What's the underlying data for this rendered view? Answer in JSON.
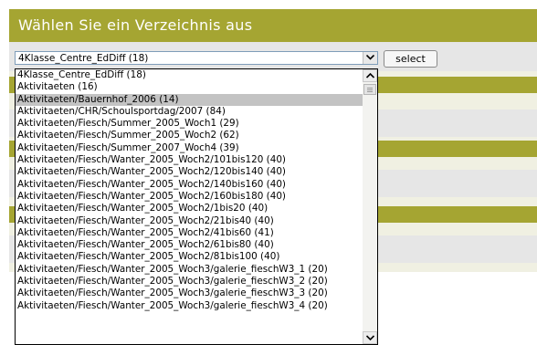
{
  "header": {
    "title": "Wählen Sie ein Verzeichnis aus"
  },
  "form": {
    "selected_value": "4Klasse_Centre_EdDiff (18)",
    "select_button_label": "select"
  },
  "dropdown": {
    "highlighted_index": 2,
    "options": [
      "4Klasse_Centre_EdDiff (18)",
      "Aktivitaeten (16)",
      "Aktivitaeten/Bauernhof_2006 (14)",
      "Aktivitaeten/CHR/Schoulsportdag/2007 (84)",
      "Aktivitaeten/Fiesch/Summer_2005_Woch1 (29)",
      "Aktivitaeten/Fiesch/Summer_2005_Woch2 (62)",
      "Aktivitaeten/Fiesch/Summer_2007_Woch4 (39)",
      "Aktivitaeten/Fiesch/Wanter_2005_Woch2/101bis120 (40)",
      "Aktivitaeten/Fiesch/Wanter_2005_Woch2/120bis140 (40)",
      "Aktivitaeten/Fiesch/Wanter_2005_Woch2/140bis160 (40)",
      "Aktivitaeten/Fiesch/Wanter_2005_Woch2/160bis180 (40)",
      "Aktivitaeten/Fiesch/Wanter_2005_Woch2/1bis20 (40)",
      "Aktivitaeten/Fiesch/Wanter_2005_Woch2/21bis40 (40)",
      "Aktivitaeten/Fiesch/Wanter_2005_Woch2/41bis60 (41)",
      "Aktivitaeten/Fiesch/Wanter_2005_Woch2/61bis80 (40)",
      "Aktivitaeten/Fiesch/Wanter_2005_Woch2/81bis100 (40)",
      "Aktivitaeten/Fiesch/Wanter_2005_Woch3/galerie_fieschW3_1 (20)",
      "Aktivitaeten/Fiesch/Wanter_2005_Woch3/galerie_fieschW3_2 (20)",
      "Aktivitaeten/Fiesch/Wanter_2005_Woch3/galerie_fieschW3_3 (20)",
      "Aktivitaeten/Fiesch/Wanter_2005_Woch3/galerie_fieschW3_4 (20)"
    ]
  },
  "icons": {
    "dropdown_arrow": "chevron-down-icon",
    "scroll_up": "scroll-up-arrow-icon",
    "scroll_down": "scroll-down-arrow-icon"
  },
  "colors": {
    "header_bg": "#a5a532",
    "header_text": "#ffffff",
    "highlight_bg": "#c3c3c3"
  }
}
